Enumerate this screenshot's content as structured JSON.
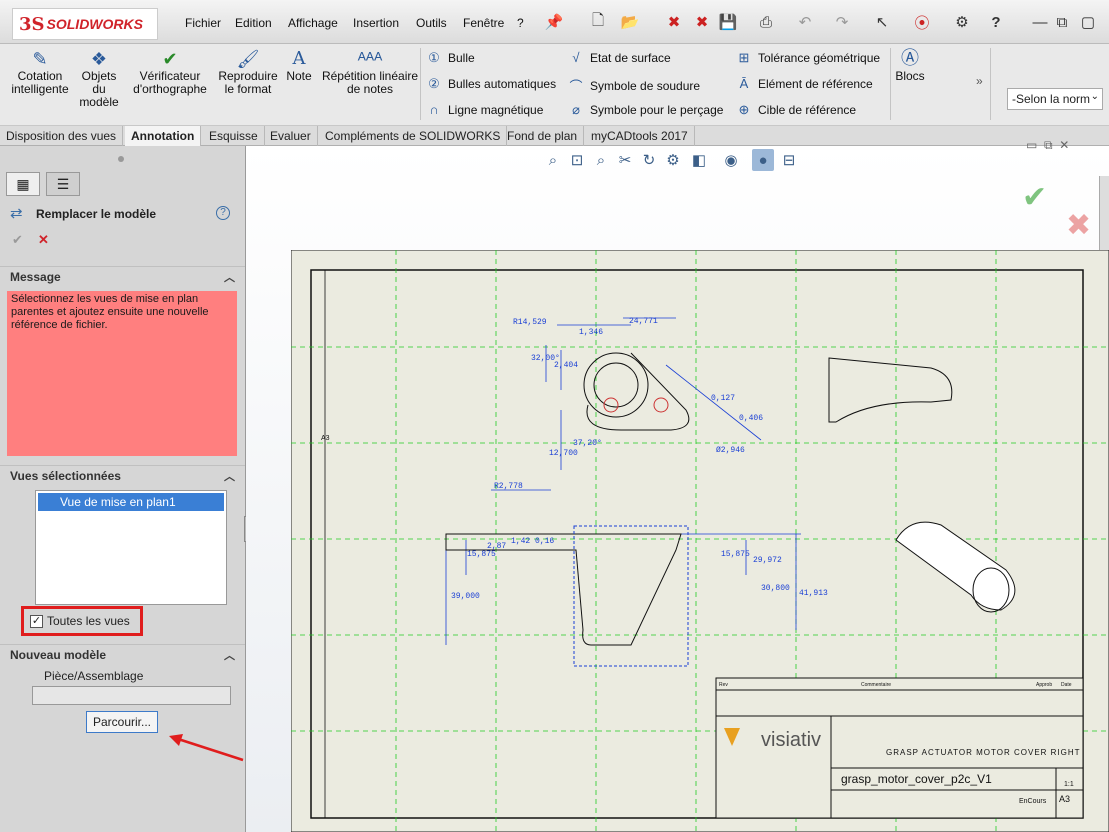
{
  "app": {
    "brand": "SOLIDWORKS",
    "brand_prefix": "3S"
  },
  "menu": [
    "Fichier",
    "Edition",
    "Affichage",
    "Insertion",
    "Outils",
    "Fenêtre",
    "?"
  ],
  "ribbon": {
    "buttons": [
      {
        "label": "Cotation intelligente"
      },
      {
        "label": "Objets du modèle"
      },
      {
        "label": "Vérificateur d'orthographe"
      },
      {
        "label": "Reproduire le format"
      },
      {
        "label": "Note"
      },
      {
        "label": "Répétition linéaire de notes"
      }
    ],
    "col1": [
      "Bulle",
      "Bulles automatiques",
      "Ligne magnétique"
    ],
    "col2": [
      "Etat de surface",
      "Symbole de soudure",
      "Symbole pour le perçage"
    ],
    "col3": [
      "Tolérance géométrique",
      "Elément de référence",
      "Cible de référence"
    ],
    "blocks": "Blocs",
    "layer_select": "-Selon la norm"
  },
  "tabs": [
    "Disposition des vues",
    "Annotation",
    "Esquisse",
    "Evaluer",
    "Compléments de SOLIDWORKS",
    "Fond de plan",
    "myCADtools 2017"
  ],
  "active_tab": "Annotation",
  "panel": {
    "title": "Remplacer le modèle",
    "message_header": "Message",
    "message": "Sélectionnez les vues de mise en plan parentes et ajoutez ensuite une nouvelle référence de fichier.",
    "views_header": "Vues sélectionnées",
    "selected_view": "Vue de mise en plan1",
    "all_views_label": "Toutes les vues",
    "all_views_checked": true,
    "new_model_header": "Nouveau modèle",
    "part_assembly_label": "Pièce/Assemblage",
    "part_assembly_value": "",
    "browse_label": "Parcourir..."
  },
  "drawing": {
    "dimensions": [
      "R14,529",
      "24,771",
      "1,346",
      "32,00°",
      "2,404",
      "0,127",
      "0,406",
      "Ø2,946",
      "12,700",
      "37,20°",
      "R2,778",
      "15,875",
      "2,87",
      "1,42",
      "0,16",
      "15,875",
      "29,972",
      "39,000",
      "30,800",
      "41,913"
    ],
    "title_block": {
      "company": "visiativ",
      "designation": "GRASP ACTUATOR MOTOR COVER RIGHT",
      "part_name": "grasp_motor_cover_p2c_V1",
      "scale": "1:1",
      "format": "A3",
      "state": "EnCours",
      "col_rev": "Rev",
      "col_comments": "Commentaire",
      "col_approved": "Approb",
      "col_date": "Date",
      "sheet_label": "A3"
    }
  }
}
